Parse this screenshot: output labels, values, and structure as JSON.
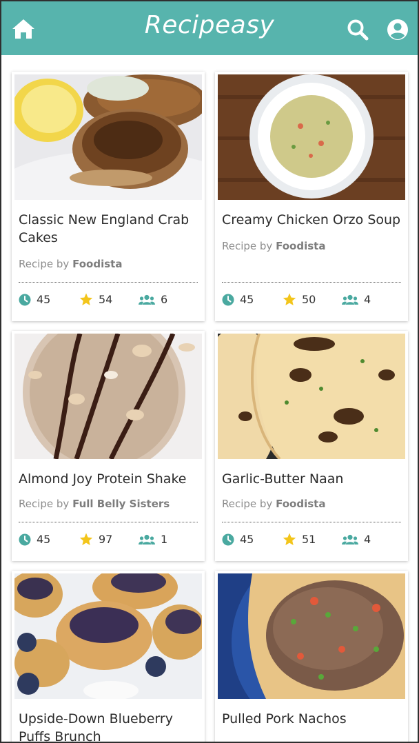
{
  "app": {
    "title": "Recipeasy",
    "icons": {
      "home": "home-icon",
      "search": "search-icon",
      "user": "user-icon"
    },
    "accent_color": "#57b4ad"
  },
  "recipes": [
    {
      "name": "Classic New England Crab Cakes",
      "by_prefix": "Recipe by",
      "source": "Foodista",
      "time": "45",
      "rating": "54",
      "servings": "6"
    },
    {
      "name": "Creamy Chicken Orzo Soup",
      "by_prefix": "Recipe by",
      "source": "Foodista",
      "time": "45",
      "rating": "50",
      "servings": "4"
    },
    {
      "name": "Almond Joy Protein Shake",
      "by_prefix": "Recipe by",
      "source": "Full Belly Sisters",
      "time": "45",
      "rating": "97",
      "servings": "1"
    },
    {
      "name": "Garlic-Butter Naan",
      "by_prefix": "Recipe by",
      "source": "Foodista",
      "time": "45",
      "rating": "51",
      "servings": "4"
    },
    {
      "name": "Upside-Down Blueberry Puffs Brunch",
      "by_prefix": "",
      "source": "",
      "time": "",
      "rating": "",
      "servings": ""
    },
    {
      "name": "Pulled Pork Nachos",
      "by_prefix": "",
      "source": "",
      "time": "",
      "rating": "",
      "servings": ""
    }
  ],
  "stat_icons": {
    "time": "clock-icon",
    "rating": "star-icon",
    "servings": "users-icon"
  }
}
